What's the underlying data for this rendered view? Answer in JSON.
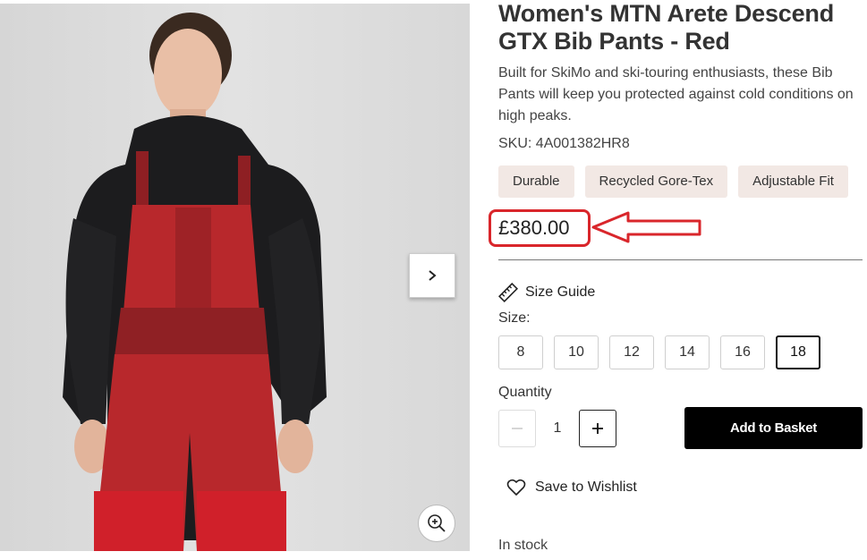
{
  "product": {
    "title": "Women's MTN Arete Descend GTX Bib Pants - Red",
    "description": "Built for SkiMo and ski-touring enthusiasts, these Bib Pants will keep you protected against cold conditions on high peaks.",
    "sku": "SKU: 4A001382HR8",
    "tags": [
      "Durable",
      "Recycled Gore-Tex",
      "Adjustable Fit"
    ],
    "price": "£380.00",
    "size_guide_label": "Size Guide",
    "size_label": "Size:",
    "sizes": [
      "8",
      "10",
      "12",
      "14",
      "16",
      "18"
    ],
    "selected_size": "18",
    "quantity_label": "Quantity",
    "quantity": "1",
    "add_to_basket_label": "Add to Basket",
    "wishlist_label": "Save to Wishlist",
    "stock_status": "In stock"
  },
  "gallery": {
    "next_icon": "chevron-right-icon",
    "zoom_icon": "zoom-in-icon"
  },
  "annotation": {
    "highlight_color": "#d9262b",
    "arrow_color": "#d9262b"
  },
  "colors": {
    "tag_bg": "#f2e8e4",
    "primary_button": "#000000",
    "pants": "#b8282c",
    "fleece": "#1c1c1e"
  }
}
